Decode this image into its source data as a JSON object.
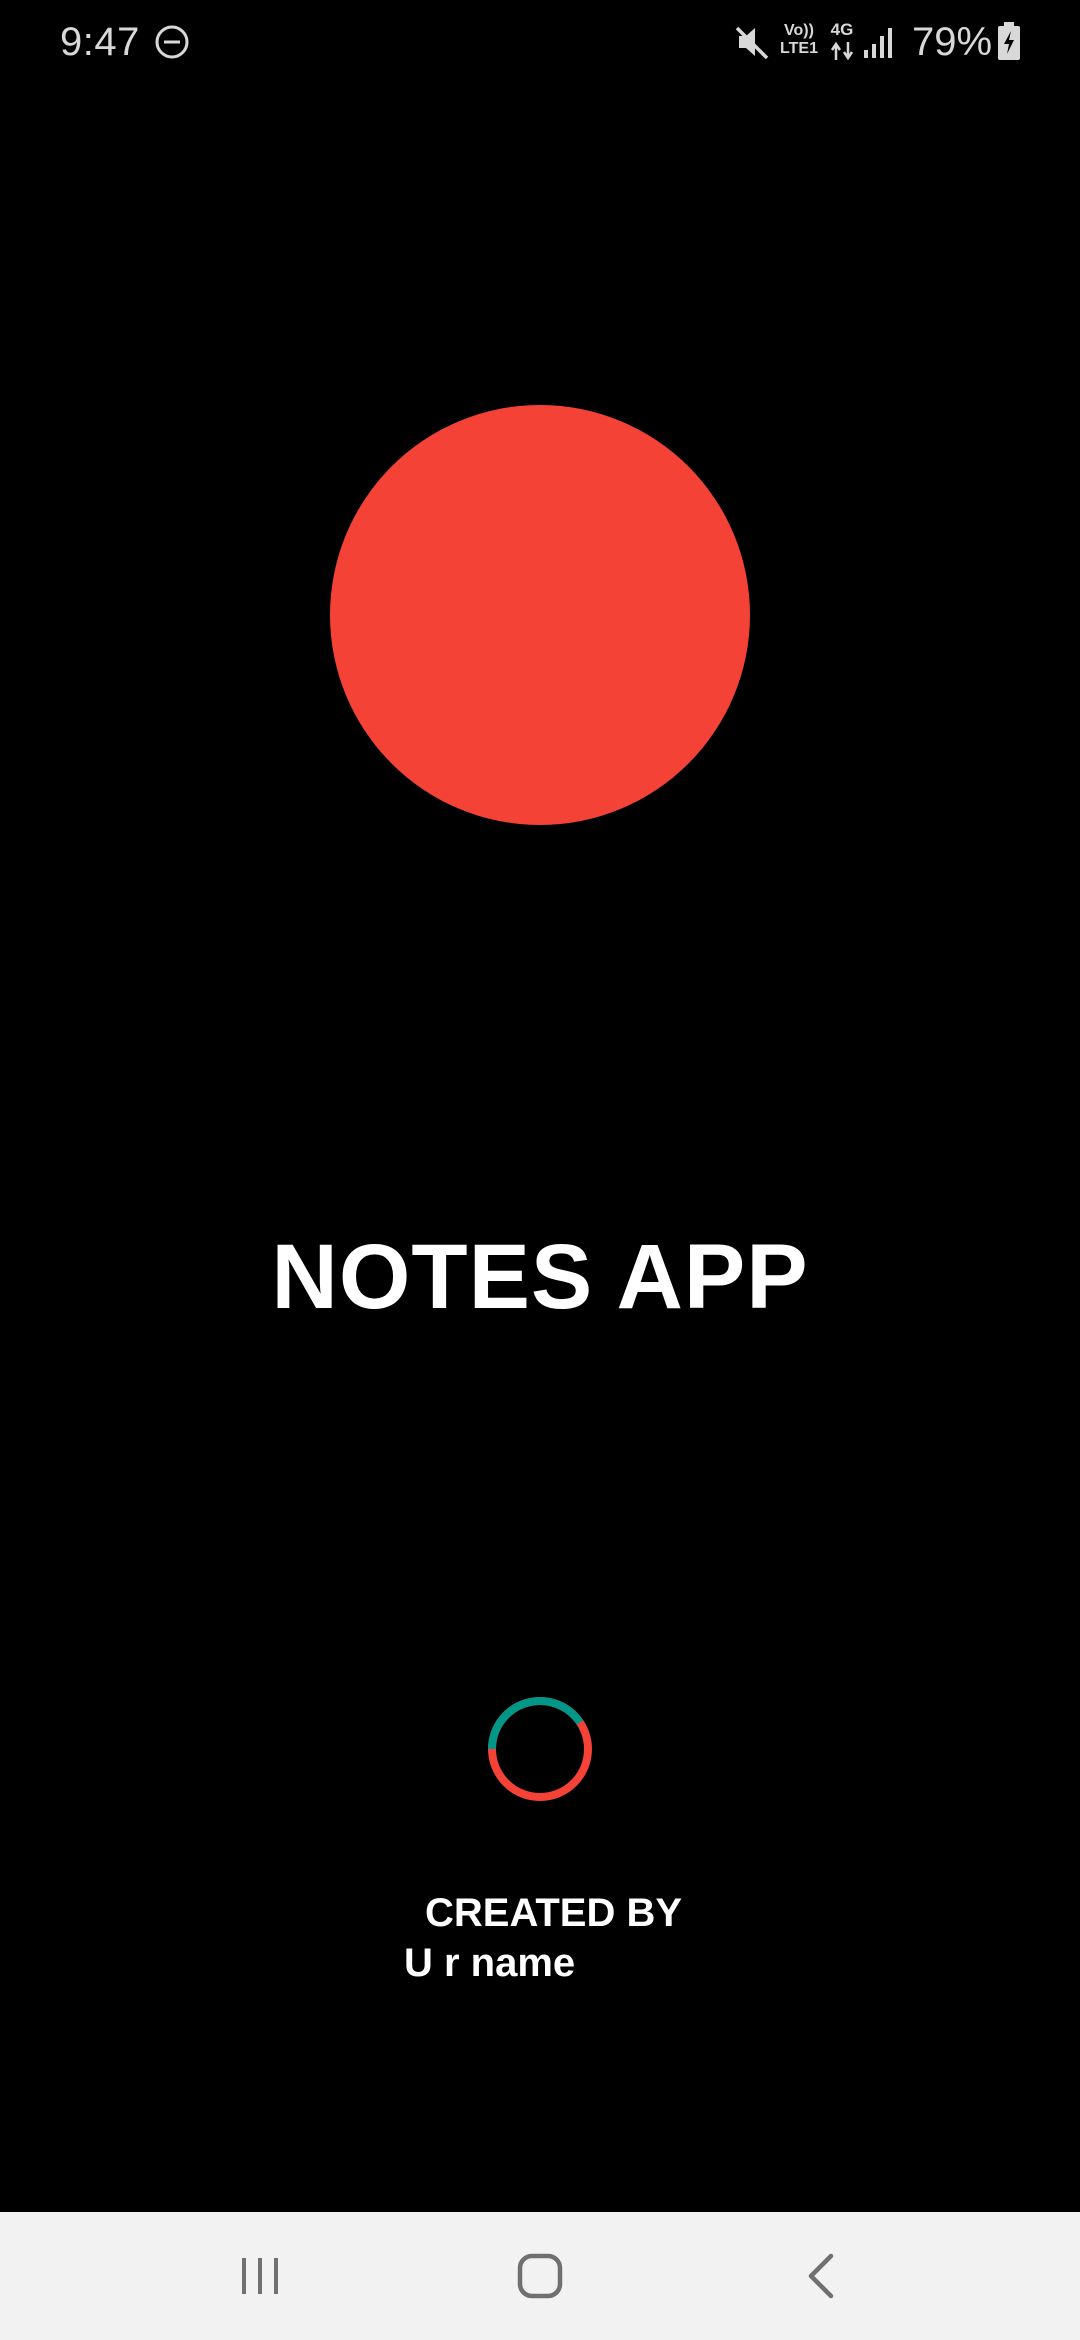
{
  "status_bar": {
    "time": "9:47",
    "volte_line1": "Vo))",
    "volte_line2": "LTE1",
    "network_type": "4G",
    "battery_percent": "79%",
    "icons": [
      "do-not-disturb-icon",
      "mute-icon",
      "volte-icon",
      "network-4g-icon",
      "signal-icon",
      "battery-charging-icon"
    ]
  },
  "splash": {
    "logo_color": "#f44336",
    "title": "NOTES APP",
    "spinner_colors": [
      "#009688",
      "#f44336"
    ],
    "created_by_label": "CREATED BY",
    "author_name": "U r name"
  },
  "nav_bar": {
    "buttons": [
      "recent-apps-icon",
      "home-icon",
      "back-icon"
    ]
  }
}
